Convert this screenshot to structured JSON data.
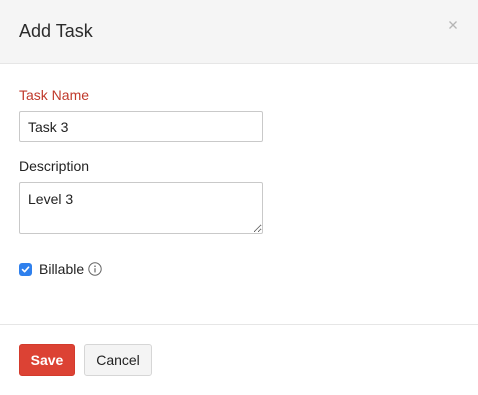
{
  "dialog": {
    "title": "Add Task",
    "close_icon": "close-icon"
  },
  "form": {
    "task_name": {
      "label": "Task Name",
      "value": "Task 3",
      "label_color": "#c0392b"
    },
    "description": {
      "label": "Description",
      "value": "Level 3"
    },
    "billable": {
      "label": "Billable",
      "checked": true,
      "info_icon": "info-icon",
      "check_color": "#2f80ed"
    }
  },
  "footer": {
    "save_label": "Save",
    "cancel_label": "Cancel",
    "save_color": "#dc4234"
  }
}
